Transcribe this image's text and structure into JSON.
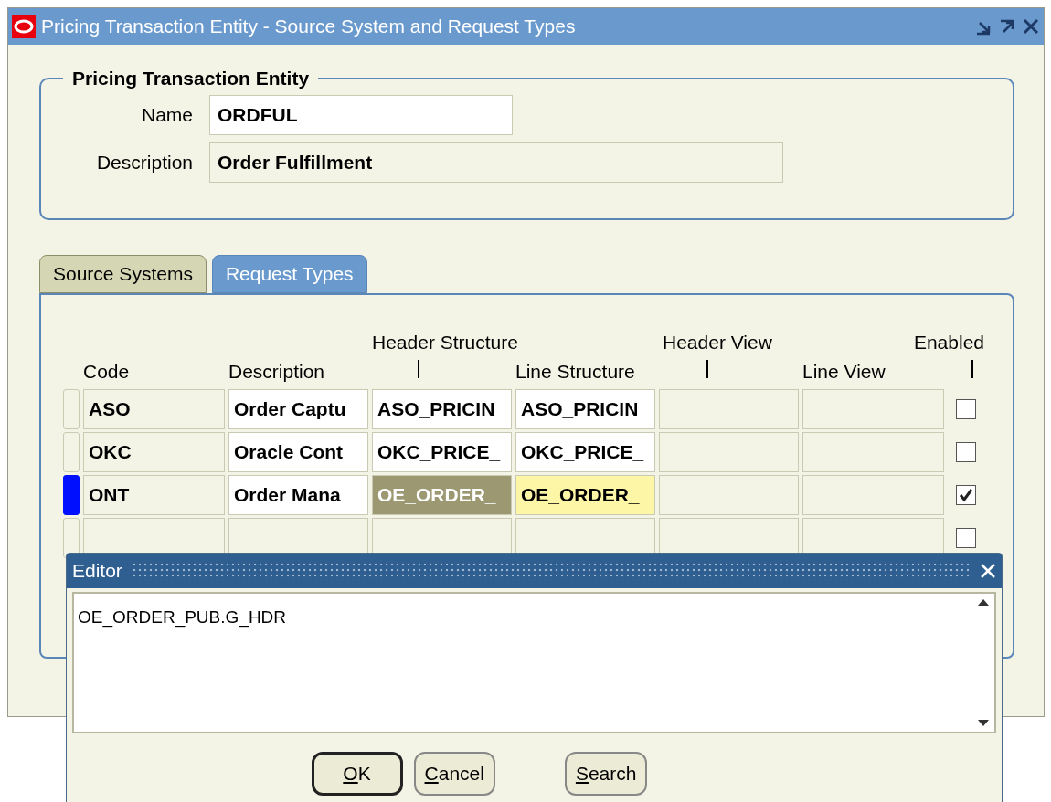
{
  "window": {
    "title": "Pricing Transaction Entity - Source System and Request Types"
  },
  "entity_group": {
    "title": "Pricing Transaction Entity",
    "fields": [
      {
        "label": "Name",
        "value": "ORDFUL",
        "editable": true
      },
      {
        "label": "Description",
        "value": "Order Fulfillment",
        "editable": false
      }
    ]
  },
  "tabs": [
    {
      "label": "Source Systems",
      "selected": false
    },
    {
      "label": "Request Types",
      "selected": true
    }
  ],
  "table": {
    "columns": [
      "Code",
      "Description",
      "Header Structure",
      "Line Structure",
      "Header View",
      "Line View",
      "Enabled"
    ],
    "rows": [
      {
        "selected": false,
        "enabled": false,
        "code": "ASO",
        "description": "Order Captu",
        "header_structure": "ASO_PRICIN",
        "line_structure": "ASO_PRICIN"
      },
      {
        "selected": false,
        "enabled": false,
        "code": "OKC",
        "description": "Oracle Cont",
        "header_structure": "OKC_PRICE_",
        "line_structure": "OKC_PRICE_"
      },
      {
        "selected": true,
        "enabled": true,
        "code": "ONT",
        "description": "Order Mana",
        "header_structure": "OE_ORDER_",
        "line_structure": "OE_ORDER_"
      },
      {
        "selected": false,
        "enabled": false
      }
    ]
  },
  "editor": {
    "title": "Editor",
    "value": "OE_ORDER_PUB.G_HDR",
    "buttons": [
      {
        "label": "OK",
        "default": true
      },
      {
        "label": "Cancel",
        "default": false
      },
      {
        "label": "Search",
        "default": false
      }
    ]
  }
}
